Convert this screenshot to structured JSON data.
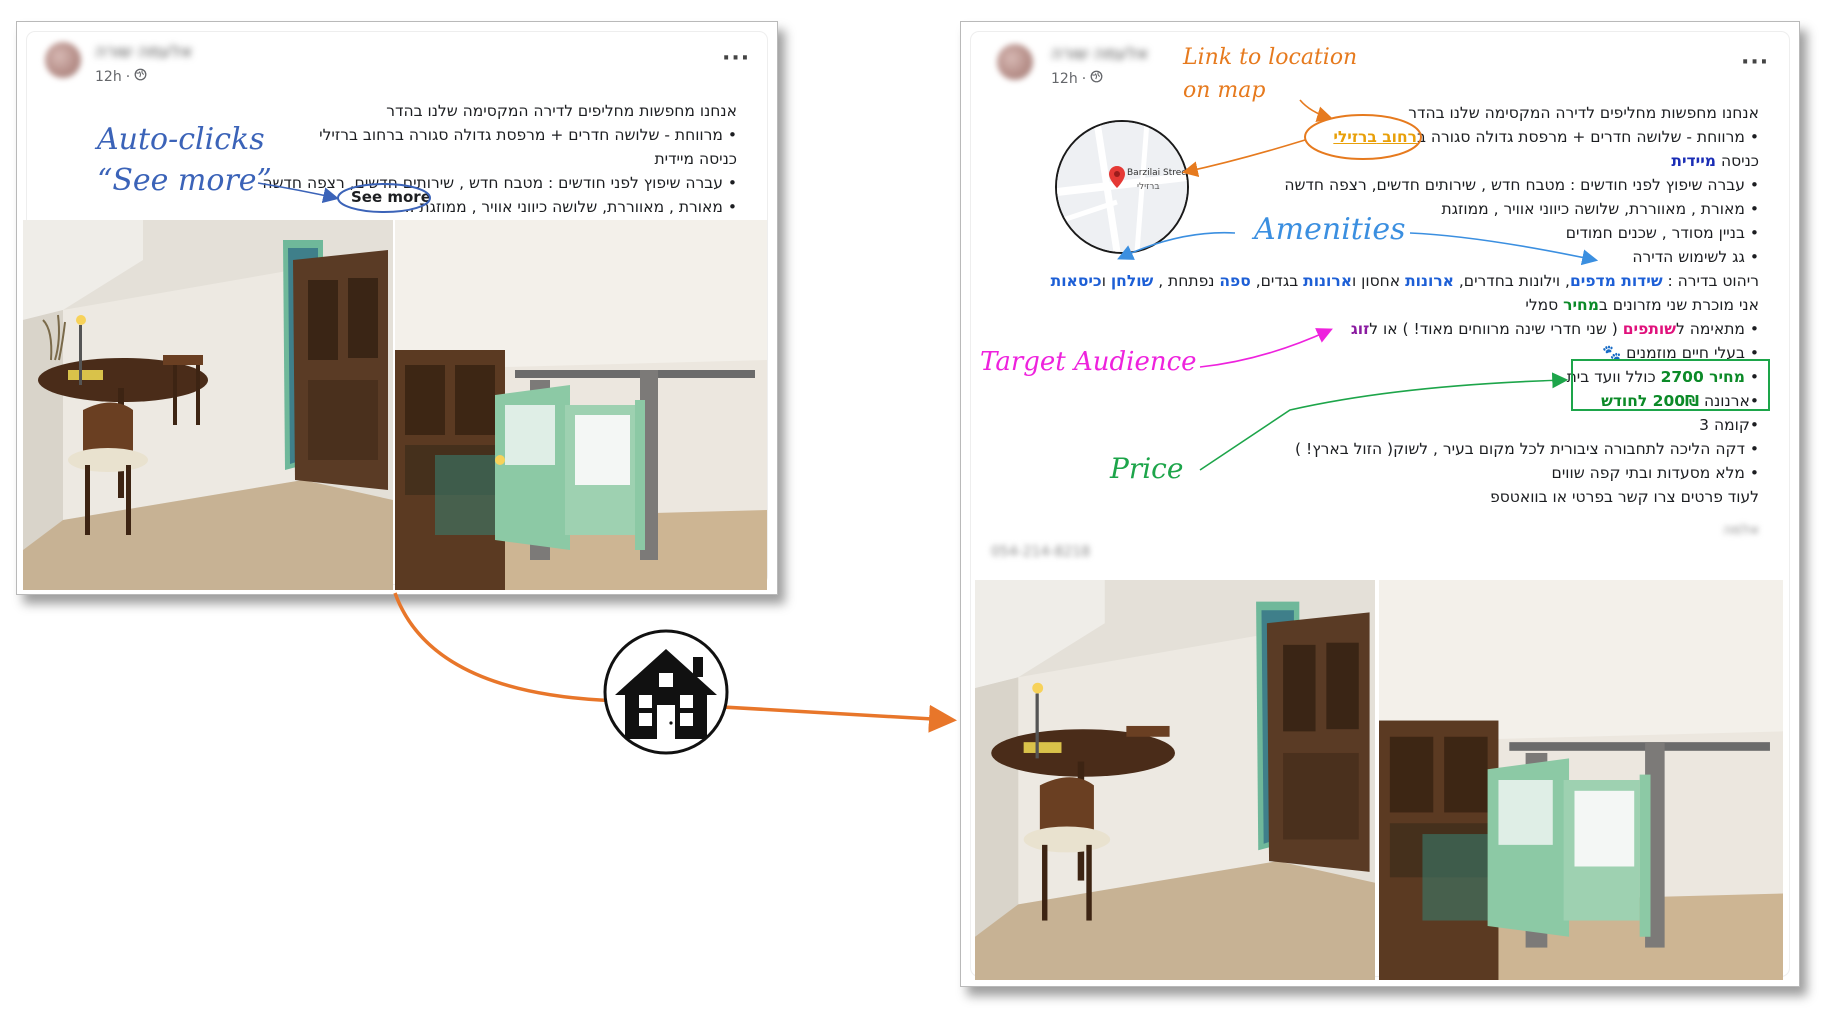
{
  "left_post": {
    "author": "אלעמה שורה",
    "time": "12h",
    "more_icon": "ellipsis-icon",
    "lines": [
      "אנחנו מחפשות מחליפים לדירה המקסימה שלנו בהדר",
      "• מרווחת - שלושה חדרים + מרפסת גדולה סגורה ברחוב ברזילי",
      "כניסה  מיידית",
      "• עברה שיפוץ לפני חודשים  : מטבח חדש , שירותים חדשים, רצפה חדשה",
      "• מאורת  , מאווררת, שלושה כיווני אוויר  ,  ממוזגת .."
    ],
    "see_more": "See more"
  },
  "right_post": {
    "author": "אלעמה שורה",
    "time": "12h",
    "more_icon": "ellipsis-icon",
    "map_label_en": "Barzilai Street",
    "map_label_he": "ברזילי",
    "lines": {
      "l1": "אנחנו מחפשות מחליפים לדירה המקסימה שלנו בהדר",
      "l2_pre": "• מרווחת - שלושה חדרים + מרפסת גדולה סגורה ב",
      "l2_street": "רחוב ",
      "l2_name": "ברזילי",
      "l3_a": "כניסה  ",
      "l3_b": "מיידית",
      "l4": "• עברה שיפוץ לפני חודשים  : מטבח חדש , שירותים חדשים, רצפה חדשה",
      "l5": "• מאורת  , מאווררת, שלושה כיווני אוויר  ,  ממוזגת",
      "l6": "• בניין מסודר , שכנים חמודים",
      "l7": "• גג לשימוש הדירה",
      "l8_a": "ריהוט בדירה : ",
      "l8_b": "שידות מדפים",
      "l8_c": ", וילונות בחדרים, ",
      "l8_d": "ארונות",
      "l8_e": " אחסון ו",
      "l8_f": "ארונות",
      "l8_g": " בגדים, ",
      "l8_h": "ספה",
      "l8_i": " נפתחת , ",
      "l8_j": "שולחן",
      "l8_k": " ו",
      "l8_l": "כיסאות",
      "l9_a": "אני מוכרת שני מזרונים ב",
      "l9_b": "מחיר",
      "l9_c": " סמלי",
      "l10_a": "• מתאימה ל",
      "l10_b": "שותפים",
      "l10_c": " ( שני חדרי שינה מרווחים מאוד! ) או ל",
      "l10_d": "זוג",
      "l11": "• בעלי חיים מוזמנים 🐾",
      "l12_a": "• ",
      "l12_b": "מחיר 2700",
      "l12_c": " כולל וועד בית",
      "l13_a": "•ארנונה ",
      "l13_b": "200₪ לחודש",
      "l14": "•קומה 3",
      "l15": "• דקה הליכה לתחבורה ציבורית לכל מקום בעיר , לשוק( הזול בארץ! )",
      "l16": "• מלא מסעדות ובתי קפה שווים",
      "l17": "לעוד פרטים צרו קשר בפרטי או בוואטספ"
    },
    "contact_name": "אלמה",
    "contact_phone": "054-214-8218"
  },
  "annotations": {
    "auto_clicks_line1": "Auto-clicks",
    "auto_clicks_line2": "“See more”",
    "link_location_line1": "Link to location",
    "link_location_line2": "on map",
    "amenities": "Amenities",
    "target_audience": "Target Audience",
    "price": "Price"
  },
  "colors": {
    "auto_clicks": "#3b63b8",
    "link_location": "#e67a1e",
    "amenities": "#3b8fe0",
    "target_audience": "#ee22dd",
    "price": "#1da54a",
    "flow_arrow": "#e8762a"
  },
  "center_icon": "house-icon"
}
